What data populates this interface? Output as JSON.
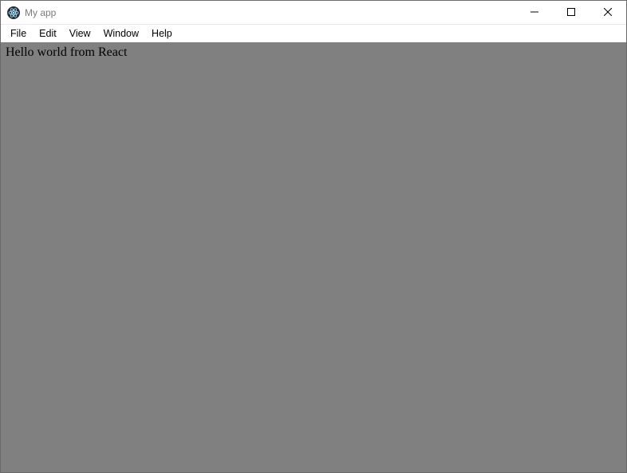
{
  "titlebar": {
    "title": "My app"
  },
  "menubar": {
    "items": [
      {
        "label": "File"
      },
      {
        "label": "Edit"
      },
      {
        "label": "View"
      },
      {
        "label": "Window"
      },
      {
        "label": "Help"
      }
    ]
  },
  "content": {
    "text": "Hello world from React"
  }
}
